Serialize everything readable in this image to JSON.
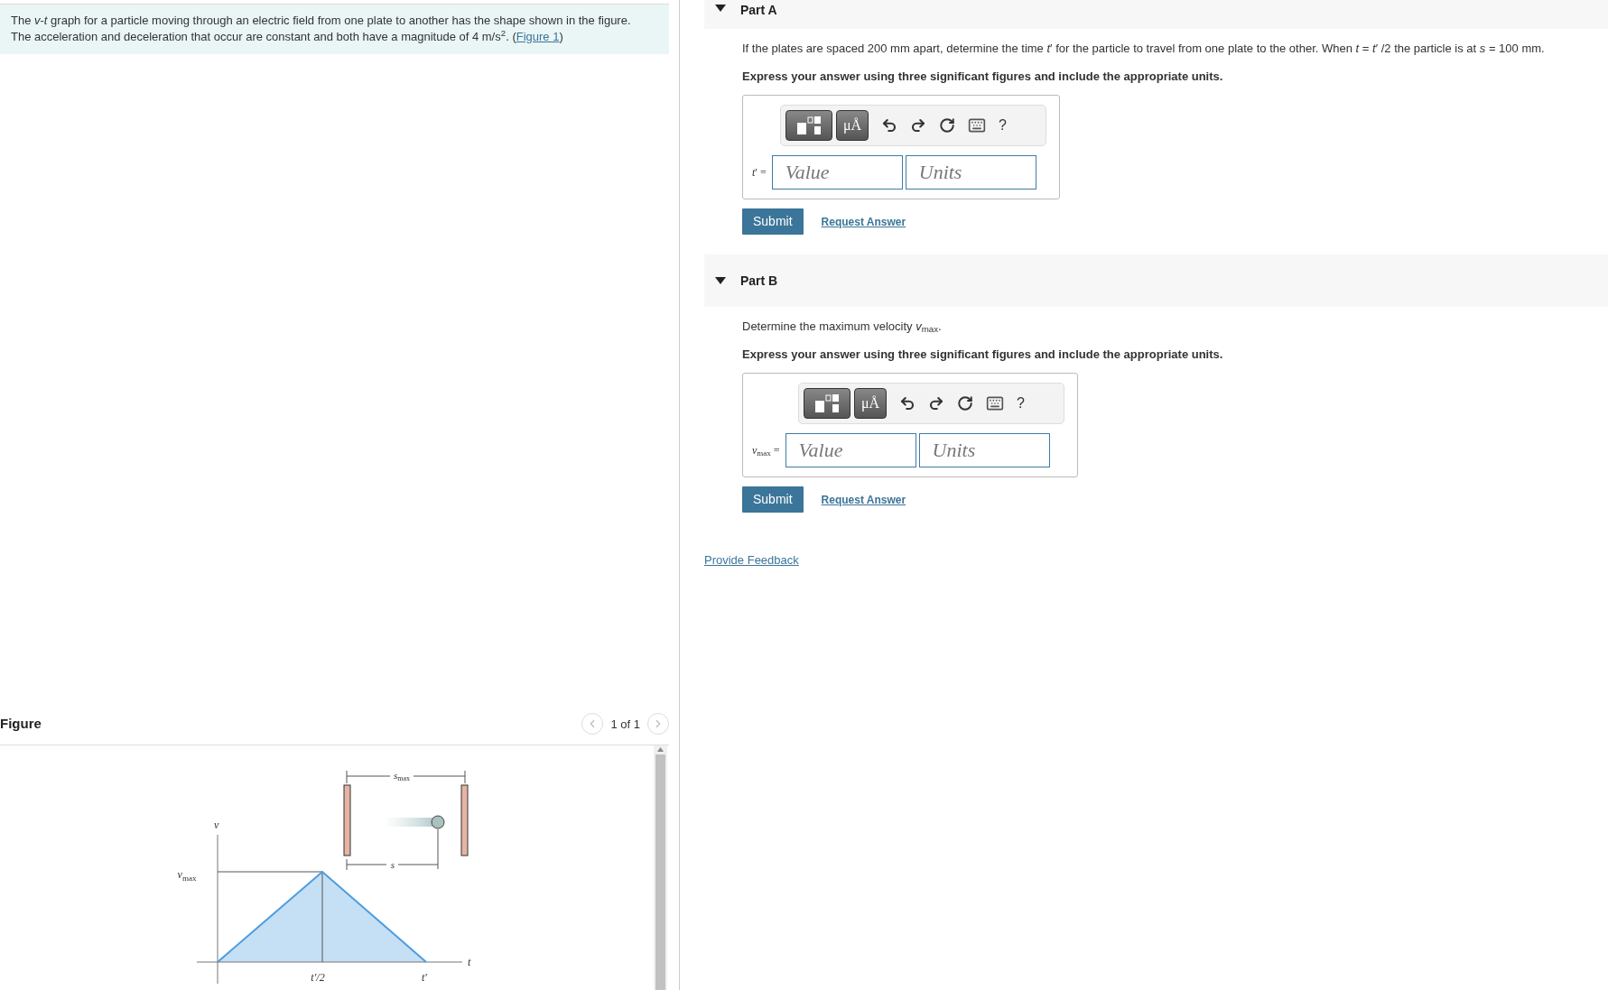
{
  "problem": {
    "text": "The *v*-*t* graph for a particle moving through an electric field from one plate to another has the shape shown in the figure. The acceleration and deceleration that occur are constant and both have a magnitude of 4 m/s$^{2}$. (",
    "link": "Figure 1",
    "after": ")"
  },
  "figure": {
    "title": "Figure",
    "pager": "1 of 1",
    "labels": {
      "v_axis": "v",
      "vmax": {
        "main": "v",
        "sub": "max"
      },
      "half_time": "t′/2",
      "end_time": "t′",
      "t_axis": "t",
      "smax": {
        "main": "s",
        "sub": "max"
      },
      "s": "s"
    }
  },
  "parts": [
    {
      "title": "Part A",
      "expanded": true,
      "prompt": "If the plates are spaced 200 mm apart, determine the time *t*′ for the particle to travel from one plate to the other. When *t* = *t*′ /2 the particle is at *s* = 100 mm.",
      "instruction": "Express your answer using three significant figures and include the appropriate units.",
      "units_button": "μÅ",
      "help": "?",
      "answer_label": "*t*′ =",
      "value_placeholder": "Value",
      "units_placeholder": "Units",
      "submit": "Submit",
      "request": "Request Answer"
    },
    {
      "title": "Part B",
      "expanded": true,
      "prompt": "Determine the maximum velocity *v*$_{max}$.",
      "instruction": "Express your answer using three significant figures and include the appropriate units.",
      "units_button": "μÅ",
      "help": "?",
      "answer_label": "*v*$_{max}$ =",
      "value_placeholder": "Value",
      "units_placeholder": "Units",
      "submit": "Submit",
      "request": "Request Answer"
    }
  ],
  "feedback_link": "Provide Feedback"
}
